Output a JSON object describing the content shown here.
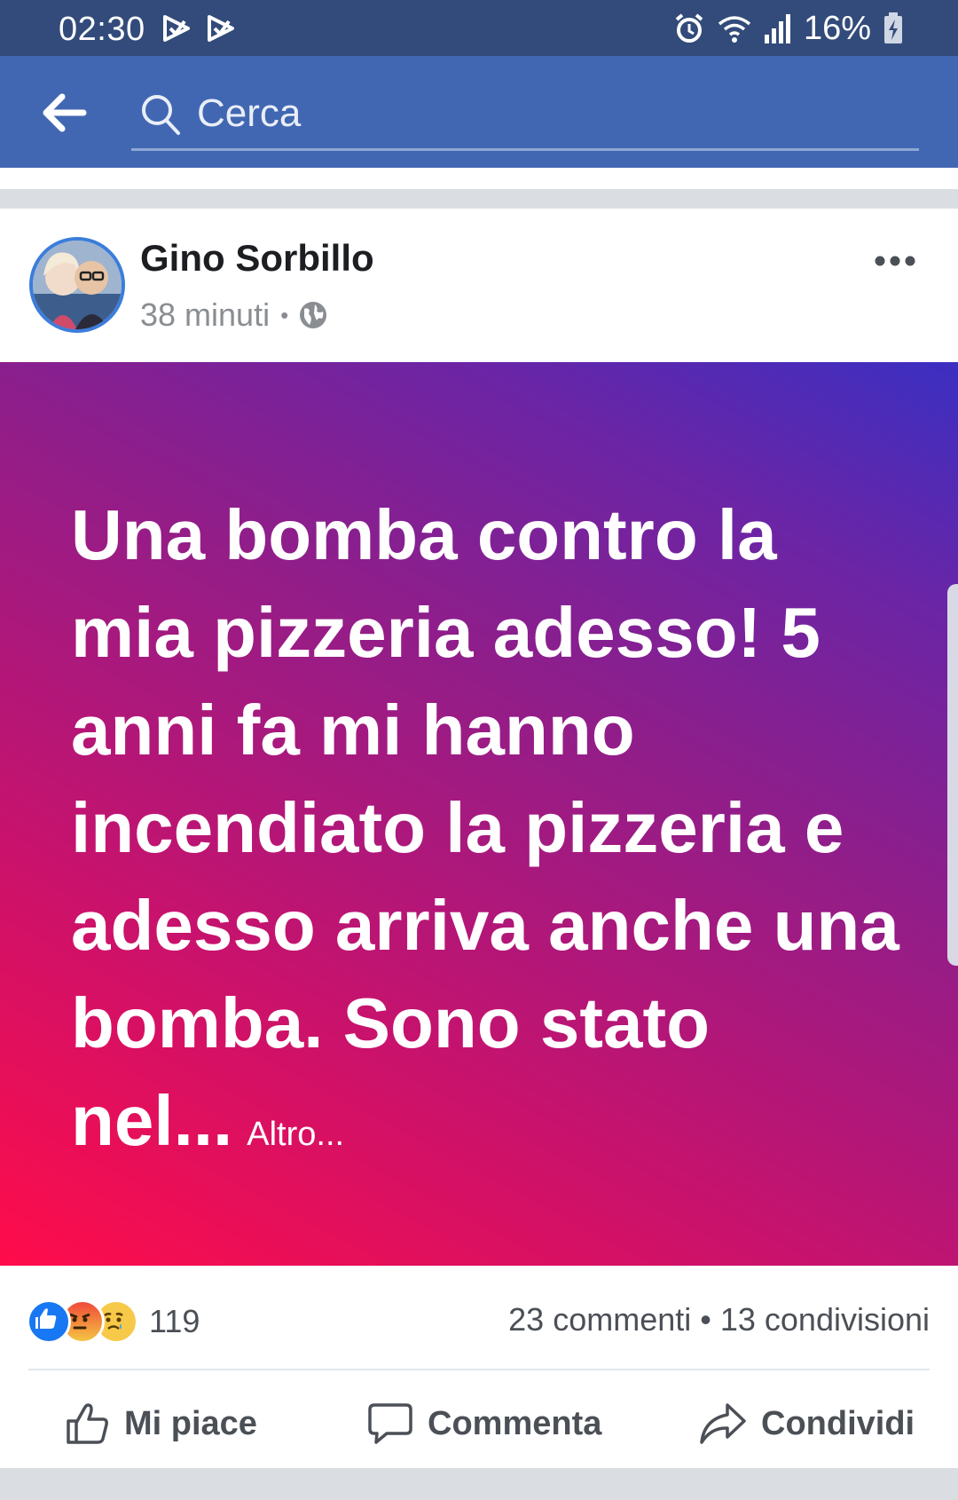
{
  "status_bar": {
    "time": "02:30",
    "battery": "16%"
  },
  "search": {
    "placeholder": "Cerca"
  },
  "post": {
    "author": "Gino Sorbillo",
    "time_ago": "38 minuti",
    "separator": "•",
    "text": "Una bomba contro la mia pizzeria adesso! 5 anni fa mi hanno incendiato la pizzeria e adesso arriva anche una bomba. Sono stato nel...",
    "see_more": "Altro...",
    "gradient_colors": [
      "#ff0c4a",
      "#c9126c",
      "#8e1e8b",
      "#6a25a6",
      "#3b2fc2"
    ]
  },
  "stats": {
    "reaction_icons": [
      "like-icon",
      "angry-icon",
      "sad-icon"
    ],
    "reaction_count": "119",
    "counts": "23 commenti • 13 condivisioni"
  },
  "actions": {
    "like": "Mi piace",
    "comment": "Commenta",
    "share": "Condividi"
  },
  "colors": {
    "status_bar": "#324b7a",
    "header": "#4267b2",
    "like_blue": "#1877f2"
  }
}
